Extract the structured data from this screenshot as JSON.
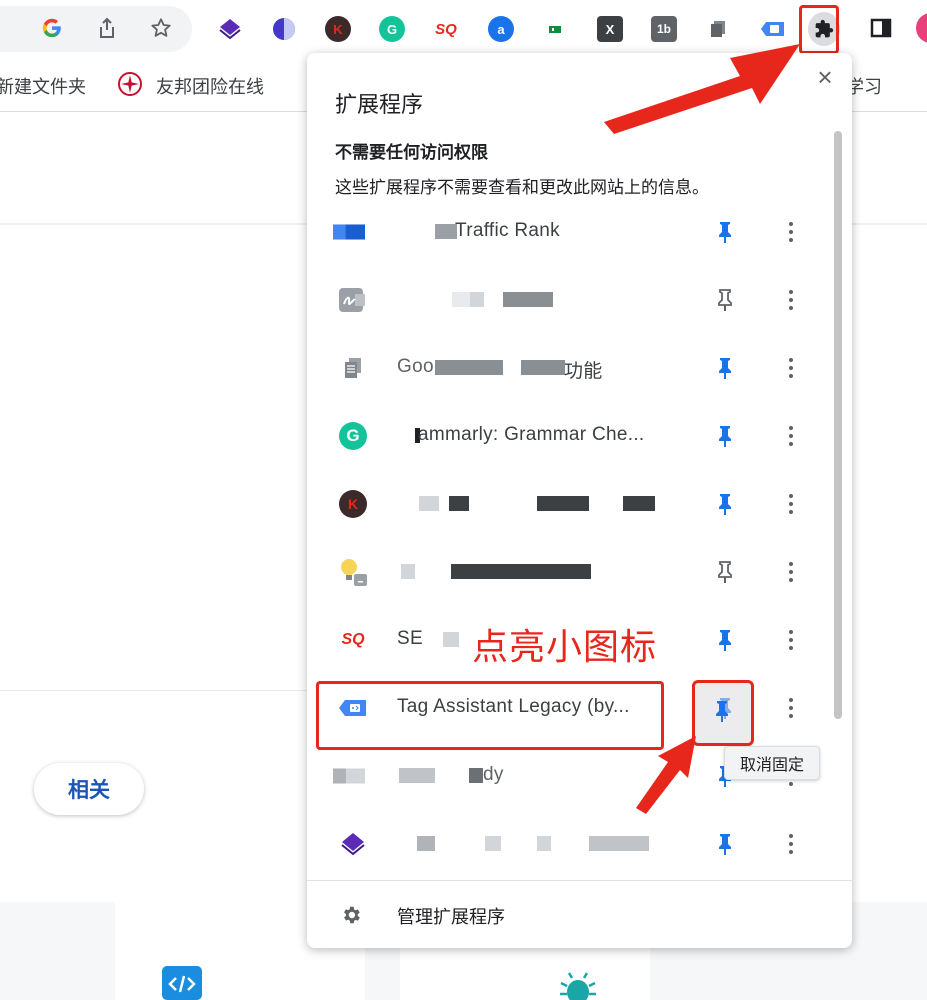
{
  "bookmarks": {
    "items": [
      {
        "label": "新建文件夹"
      },
      {
        "label": "友邦团险在线"
      },
      {
        "label": "学习"
      }
    ]
  },
  "popup": {
    "title": "扩展程序",
    "close_symbol": "×",
    "section_title": "不需要任何访问权限",
    "section_desc": "这些扩展程序不需要查看和更改此网站上的信息。",
    "extensions": [
      {
        "name": "Traffic Rank",
        "icon": "traffic-rank-icon",
        "pinned": true
      },
      {
        "name": "",
        "icon": "signature-icon",
        "pinned": false
      },
      {
        "name": "功能",
        "icon": "docs-copy-icon",
        "pinned": true
      },
      {
        "name": "ammarly: Grammar Che...",
        "icon": "grammarly-icon",
        "pinned": true
      },
      {
        "name": "",
        "icon": "k-circle-icon",
        "pinned": true
      },
      {
        "name": "",
        "icon": "lightbulb-icon",
        "pinned": false
      },
      {
        "name": "SE",
        "icon": "seo-sq-icon",
        "pinned": true
      },
      {
        "name": "Tag Assistant Legacy (by...",
        "icon": "tag-assistant-icon",
        "pinned": true
      },
      {
        "name": "dy",
        "icon": "blurred-icon",
        "pinned": true
      },
      {
        "name": "",
        "icon": "purple-diamond-icon",
        "pinned": true
      }
    ],
    "footer_label": "管理扩展程序"
  },
  "page": {
    "related_button": "相关"
  },
  "annotation": {
    "callout": "点亮小图标",
    "tooltip": "取消固定"
  },
  "colors": {
    "accent_red": "#e8271c",
    "pin_blue": "#1a73e8",
    "pin_grey": "#5f6368"
  }
}
